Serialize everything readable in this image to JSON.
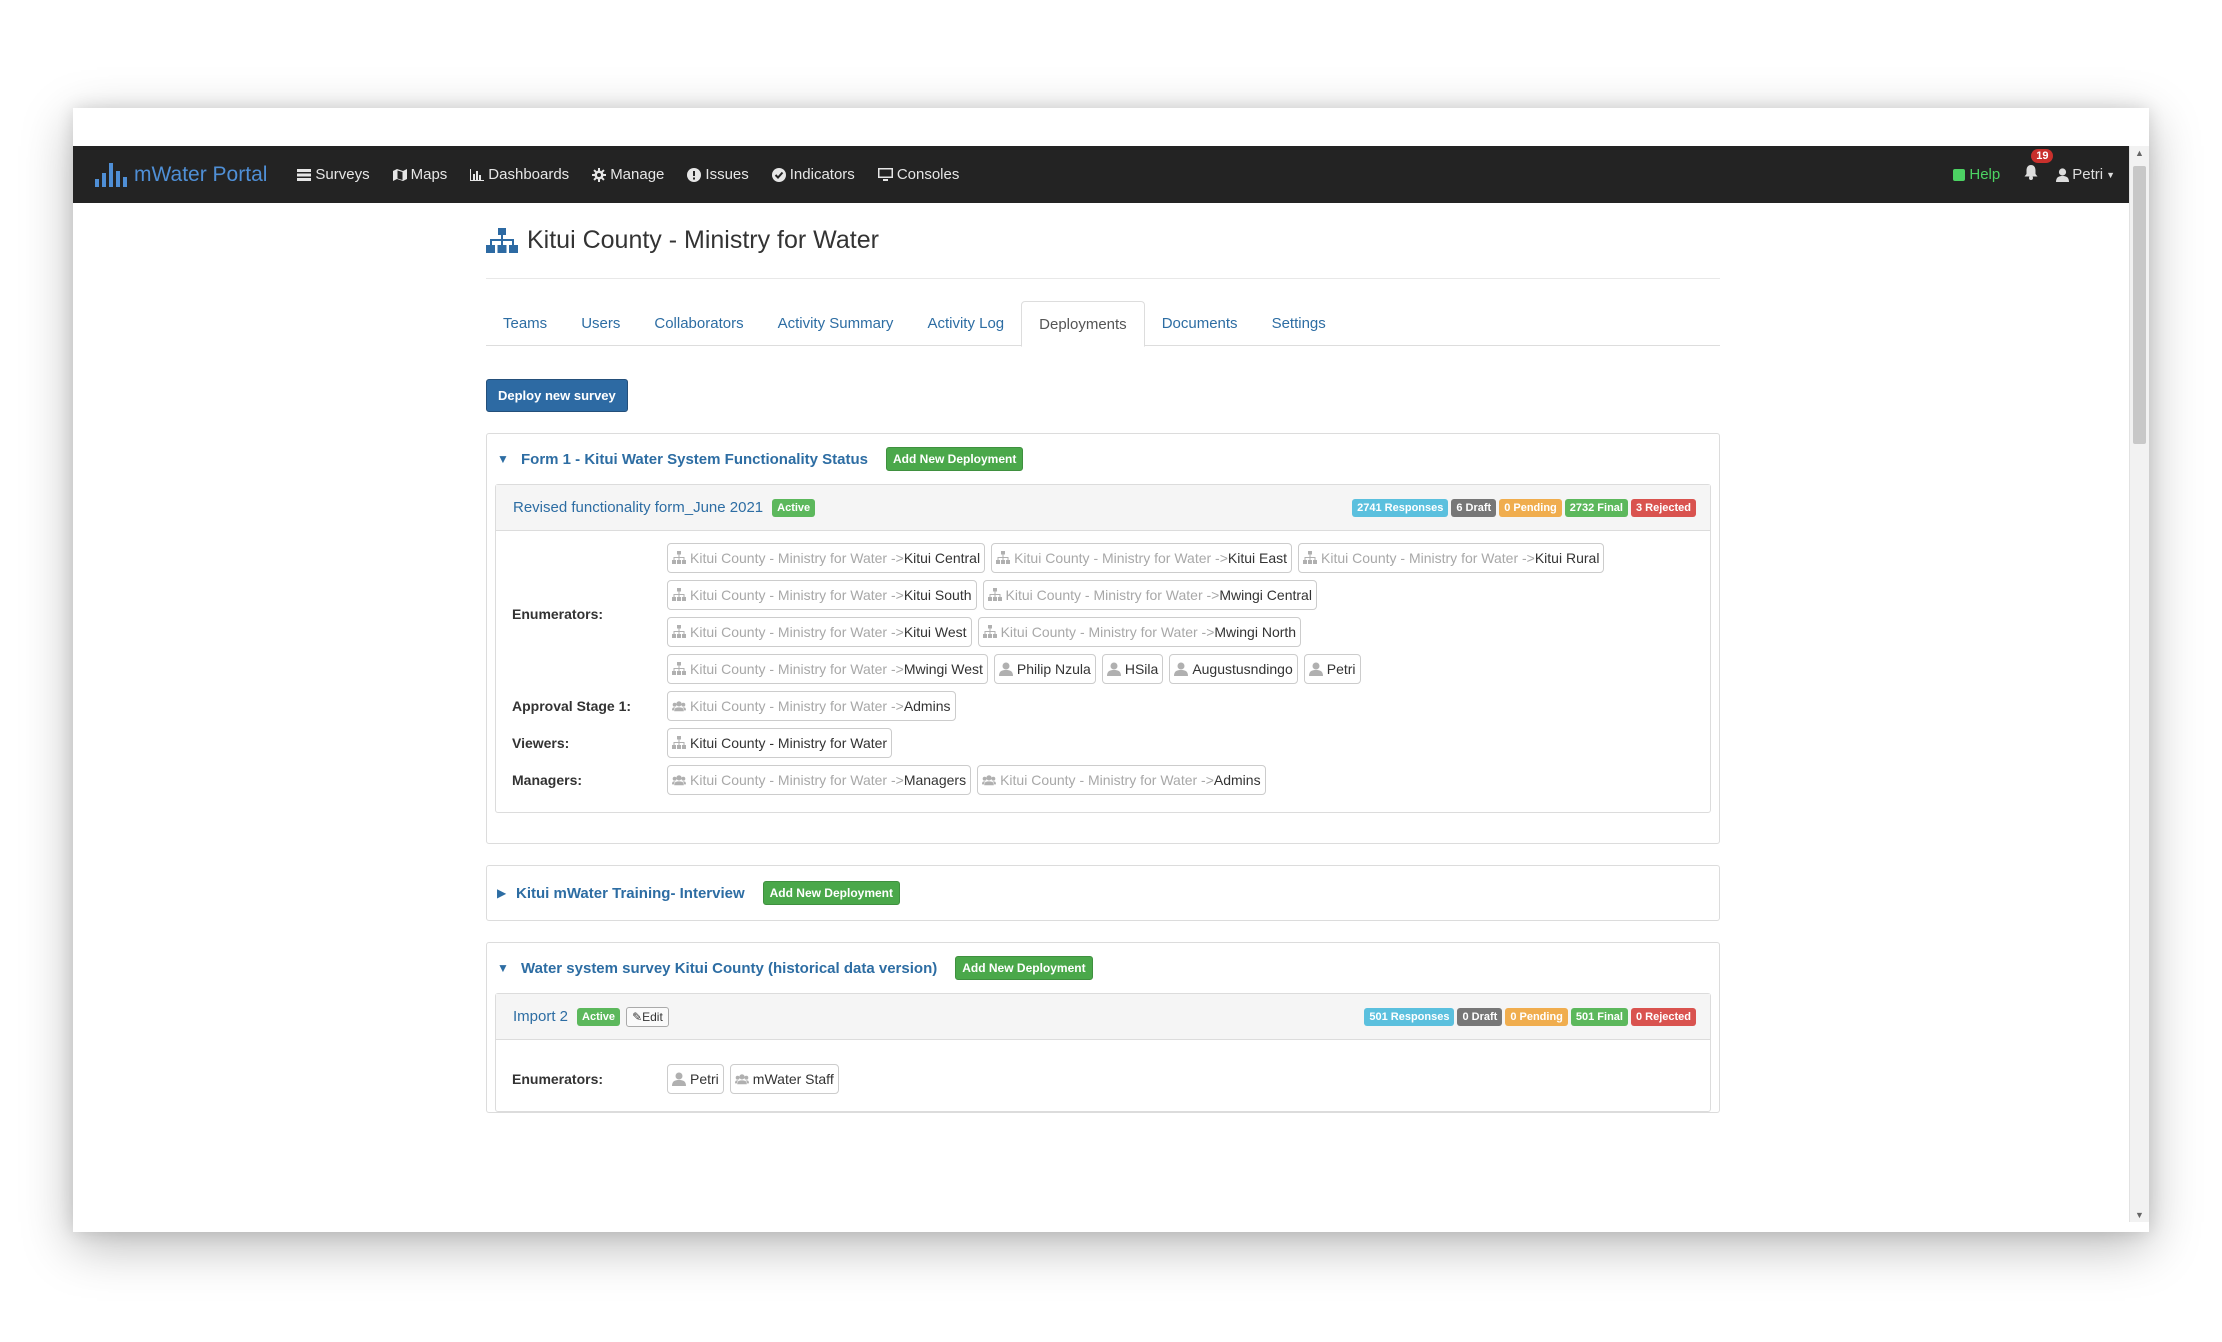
{
  "app": {
    "brand": "mWater Portal"
  },
  "nav": {
    "items": [
      {
        "label": "Surveys",
        "icon": "table-icon"
      },
      {
        "label": "Maps",
        "icon": "map-icon"
      },
      {
        "label": "Dashboards",
        "icon": "bar-chart-icon"
      },
      {
        "label": "Manage",
        "icon": "gear-icon"
      },
      {
        "label": "Issues",
        "icon": "info-icon"
      },
      {
        "label": "Indicators",
        "icon": "check-circle-icon"
      },
      {
        "label": "Consoles",
        "icon": "monitor-icon"
      }
    ],
    "help": "Help",
    "notifications": "19",
    "user": "Petri"
  },
  "org": {
    "title": "Kitui County - Ministry for Water"
  },
  "tabs": [
    "Teams",
    "Users",
    "Collaborators",
    "Activity Summary",
    "Activity Log",
    "Deployments",
    "Documents",
    "Settings"
  ],
  "active_tab": "Deployments",
  "deploy_button": "Deploy new survey",
  "add_deployment": "Add New Deployment",
  "surveys": [
    {
      "title": "Form 1 - Kitui Water System Functionality Status",
      "expanded": true,
      "deployment": {
        "name": "Revised functionality form_June 2021",
        "status": "Active",
        "stats": {
          "responses": "2741 Responses",
          "draft": "6 Draft",
          "pending": "0 Pending",
          "final": "2732 Final",
          "rejected": "3 Rejected"
        },
        "rows": [
          {
            "label": "Enumerators:",
            "chips": [
              {
                "prefix": "Kitui County - Ministry for Water -> ",
                "name": "Kitui Central",
                "type": "org"
              },
              {
                "prefix": "Kitui County - Ministry for Water -> ",
                "name": "Kitui East",
                "type": "org"
              },
              {
                "prefix": "Kitui County - Ministry for Water -> ",
                "name": "Kitui Rural",
                "type": "org"
              },
              {
                "prefix": "Kitui County - Ministry for Water -> ",
                "name": "Kitui South",
                "type": "org"
              },
              {
                "prefix": "Kitui County - Ministry for Water -> ",
                "name": "Mwingi Central",
                "type": "org"
              },
              {
                "prefix": "Kitui County - Ministry for Water -> ",
                "name": "Kitui West",
                "type": "org"
              },
              {
                "prefix": "Kitui County - Ministry for Water -> ",
                "name": "Mwingi North",
                "type": "org"
              },
              {
                "prefix": "Kitui County - Ministry for Water -> ",
                "name": "Mwingi West",
                "type": "org"
              },
              {
                "prefix": "",
                "name": "Philip Nzula",
                "type": "user"
              },
              {
                "prefix": "",
                "name": "HSila",
                "type": "user"
              },
              {
                "prefix": "",
                "name": "Augustusndingo",
                "type": "user"
              },
              {
                "prefix": "",
                "name": "Petri",
                "type": "user"
              }
            ]
          },
          {
            "label": "Approval Stage 1:",
            "chips": [
              {
                "prefix": "Kitui County - Ministry for Water -> ",
                "name": "Admins",
                "type": "group"
              }
            ]
          },
          {
            "label": "Viewers:",
            "chips": [
              {
                "prefix": "",
                "name": "Kitui County - Ministry for Water",
                "type": "org"
              }
            ]
          },
          {
            "label": "Managers:",
            "chips": [
              {
                "prefix": "Kitui County - Ministry for Water -> ",
                "name": "Managers",
                "type": "group"
              },
              {
                "prefix": "Kitui County - Ministry for Water -> ",
                "name": "Admins",
                "type": "group"
              }
            ]
          }
        ]
      }
    },
    {
      "title": "Kitui mWater Training- Interview",
      "expanded": false
    },
    {
      "title": "Water system survey Kitui County (historical data version)",
      "expanded": true,
      "deployment": {
        "name": "Import 2",
        "status": "Active",
        "edit": "Edit",
        "stats": {
          "responses": "501 Responses",
          "draft": "0 Draft",
          "pending": "0 Pending",
          "final": "501 Final",
          "rejected": "0 Rejected"
        },
        "rows": [
          {
            "label": "Enumerators:",
            "chips": [
              {
                "prefix": "",
                "name": "Petri",
                "type": "user"
              },
              {
                "prefix": "",
                "name": "mWater Staff",
                "type": "group"
              }
            ]
          }
        ]
      }
    }
  ]
}
